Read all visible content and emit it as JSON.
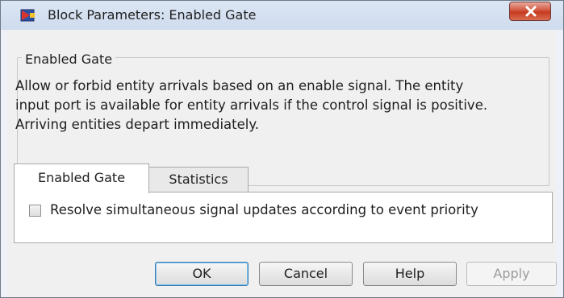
{
  "window": {
    "title": "Block Parameters: Enabled Gate"
  },
  "block": {
    "group_title": "Enabled Gate",
    "description": "Allow or forbid entity arrivals based on an enable signal. The entity\ninput port is available for entity arrivals if the control signal is positive.\nArriving entities depart immediately."
  },
  "tabs": [
    {
      "label": "Enabled Gate",
      "active": true
    },
    {
      "label": "Statistics",
      "active": false
    }
  ],
  "params": {
    "resolve_checkbox_label": "Resolve simultaneous signal updates according to event priority",
    "resolve_checked": false
  },
  "buttons": {
    "ok": "OK",
    "cancel": "Cancel",
    "help": "Help",
    "apply": "Apply",
    "apply_enabled": false
  },
  "colors": {
    "close_button": "#c63a20",
    "default_button_border": "#3c7fb1"
  },
  "icons": {
    "app": "simulink-block-icon",
    "close": "close-icon"
  }
}
